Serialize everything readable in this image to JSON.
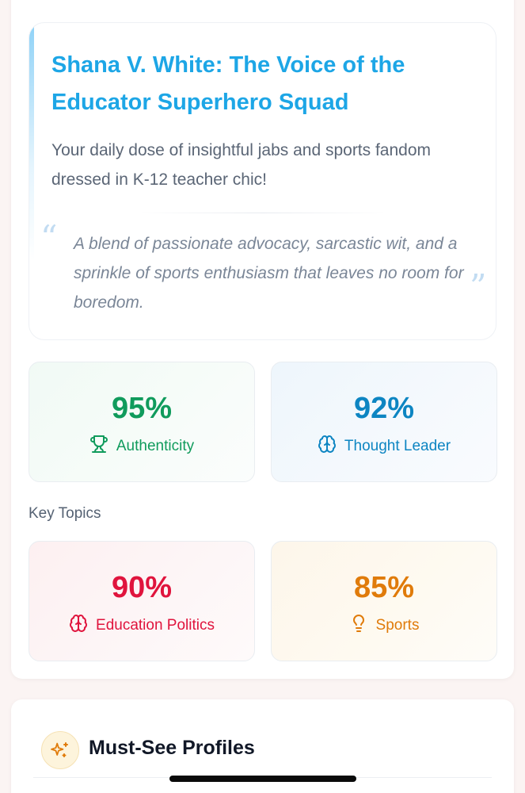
{
  "hero": {
    "title": "Shana V. White: The Voice of the Educator Superhero Squad",
    "subtitle": "Your daily dose of insightful jabs and sports fandom dressed in K-12 teacher chic!",
    "quote": "A blend of passionate advocacy, sarcastic wit, and a sprinkle of sports enthusiasm that leaves no room for boredom.",
    "quote_open_mark": "“",
    "quote_close_mark": "”"
  },
  "stats": [
    {
      "value": "95%",
      "label": "Authenticity",
      "icon": "trophy-icon",
      "color": "#109b5c"
    },
    {
      "value": "92%",
      "label": "Thought Leader",
      "icon": "brain-icon",
      "color": "#0d85c2"
    }
  ],
  "key_topics": {
    "label": "Key Topics",
    "items": [
      {
        "value": "90%",
        "label": "Education Politics",
        "icon": "brain-icon",
        "color": "#e0143d"
      },
      {
        "value": "85%",
        "label": "Sports",
        "icon": "lightbulb-icon",
        "color": "#e07b0a"
      }
    ]
  },
  "profiles": {
    "title": "Must-See Profiles",
    "icon": "sparkles-icon",
    "accent": "#e07b0a"
  },
  "colors": {
    "title_blue": "#1da6e6",
    "page_background": "#fbf4f3"
  }
}
